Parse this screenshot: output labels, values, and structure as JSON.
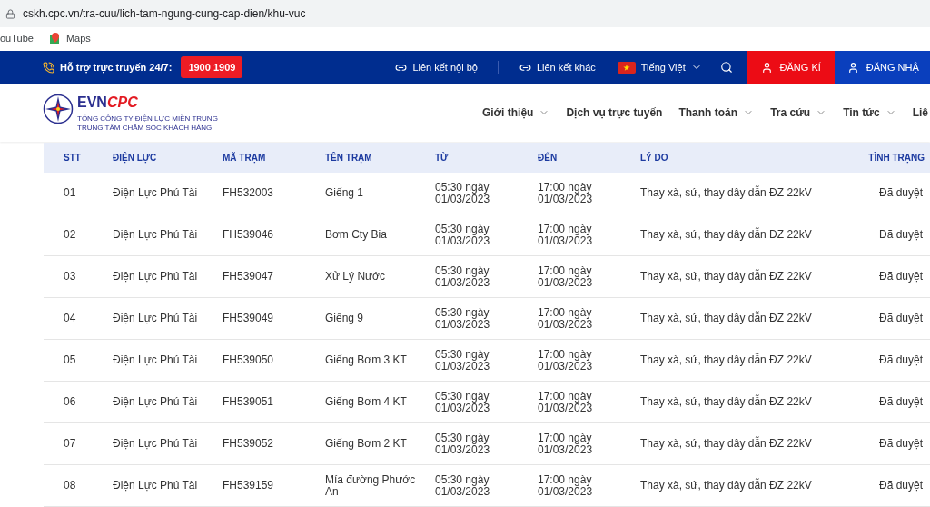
{
  "browser": {
    "url": "cskh.cpc.vn/tra-cuu/lich-tam-ngung-cung-cap-dien/khu-vuc",
    "bookmarks": [
      "ouTube",
      "Maps"
    ]
  },
  "topbar": {
    "support_label": "Hỗ trợ trực truyến 24/7:",
    "hotline": "1900 1909",
    "links": [
      "Liên kết nội bộ",
      "Liên kết khác"
    ],
    "language": "Tiếng Việt",
    "register": "ĐĂNG KÍ",
    "login": "ĐĂNG NHẬ"
  },
  "header": {
    "logo_text": "EVN",
    "logo_accent": "CPC",
    "org_lines": [
      "TỔNG CÔNG TY ĐIỆN LỰC MIỀN TRUNG",
      "TRUNG TÂM CHĂM SÓC KHÁCH HÀNG"
    ],
    "nav": [
      {
        "label": "Giới thiệu",
        "dropdown": true
      },
      {
        "label": "Dịch vụ trực tuyến",
        "dropdown": false
      },
      {
        "label": "Thanh toán",
        "dropdown": true
      },
      {
        "label": "Tra cứu",
        "dropdown": true
      },
      {
        "label": "Tin tức",
        "dropdown": true
      },
      {
        "label": "Liê",
        "dropdown": false
      }
    ]
  },
  "table": {
    "columns": [
      "STT",
      "ĐIỆN LỰC",
      "MÃ TRẠM",
      "TÊN TRẠM",
      "TỪ",
      "ĐẾN",
      "LÝ DO",
      "TÌNH TRẠNG"
    ],
    "rows": [
      [
        "01",
        "Điện Lực Phú Tài",
        "FH532003",
        "Giếng 1",
        "05:30 ngày 01/03/2023",
        "17:00 ngày 01/03/2023",
        "Thay xà, sứ, thay dây dẫn ĐZ 22kV",
        "Đã duyệt"
      ],
      [
        "02",
        "Điện Lực Phú Tài",
        "FH539046",
        "Bơm Cty Bia",
        "05:30 ngày 01/03/2023",
        "17:00 ngày 01/03/2023",
        "Thay xà, sứ, thay dây dẫn ĐZ 22kV",
        "Đã duyệt"
      ],
      [
        "03",
        "Điện Lực Phú Tài",
        "FH539047",
        "Xử Lý Nước",
        "05:30 ngày 01/03/2023",
        "17:00 ngày 01/03/2023",
        "Thay xà, sứ, thay dây dẫn ĐZ 22kV",
        "Đã duyệt"
      ],
      [
        "04",
        "Điện Lực Phú Tài",
        "FH539049",
        "Giếng 9",
        "05:30 ngày 01/03/2023",
        "17:00 ngày 01/03/2023",
        "Thay xà, sứ, thay dây dẫn ĐZ 22kV",
        "Đã duyệt"
      ],
      [
        "05",
        "Điện Lực Phú Tài",
        "FH539050",
        "Giếng Bơm 3 KT",
        "05:30 ngày 01/03/2023",
        "17:00 ngày 01/03/2023",
        "Thay xà, sứ, thay dây dẫn ĐZ 22kV",
        "Đã duyệt"
      ],
      [
        "06",
        "Điện Lực Phú Tài",
        "FH539051",
        "Giếng Bơm 4 KT",
        "05:30 ngày 01/03/2023",
        "17:00 ngày 01/03/2023",
        "Thay xà, sứ, thay dây dẫn ĐZ 22kV",
        "Đã duyệt"
      ],
      [
        "07",
        "Điện Lực Phú Tài",
        "FH539052",
        "Giếng Bơm 2 KT",
        "05:30 ngày 01/03/2023",
        "17:00 ngày 01/03/2023",
        "Thay xà, sứ, thay dây dẫn ĐZ 22kV",
        "Đã duyệt"
      ],
      [
        "08",
        "Điện Lực Phú Tài",
        "FH539159",
        "Mía đường Phước An",
        "05:30 ngày 01/03/2023",
        "17:00 ngày 01/03/2023",
        "Thay xà, sứ, thay dây dẫn ĐZ 22kV",
        "Đã duyệt"
      ]
    ]
  }
}
